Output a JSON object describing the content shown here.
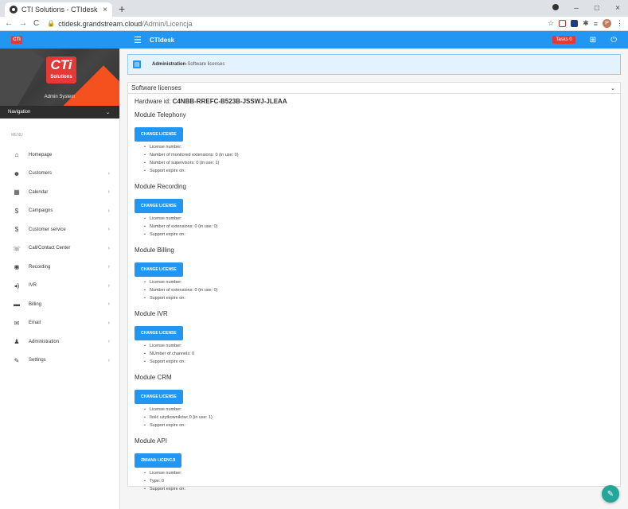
{
  "browser": {
    "tab_title": "CTI Solutions - CTIdesk",
    "tab_close": "×",
    "new_tab": "+",
    "url_host": "ctidesk.grandstream.cloud",
    "url_path": "/Admin/Licencja",
    "win_min": "–",
    "win_max": "□",
    "win_close": "×",
    "profile_initial": "P"
  },
  "header": {
    "brand": "CTIdesk",
    "tasks_label": "Tasks 0",
    "logo_mini": "CTi"
  },
  "sidebar": {
    "logo_big": "CTi",
    "logo_small": "Solutions",
    "user_name": "Admin System",
    "navigation_label": "Navigation",
    "menu_label": "MENU",
    "items": [
      {
        "label": "Homepage",
        "icon": "⌂",
        "chev": ""
      },
      {
        "label": "Customers",
        "icon": "☻",
        "chev": "›"
      },
      {
        "label": "Calendar",
        "icon": "▦",
        "chev": "›"
      },
      {
        "label": "Campaigns",
        "icon": "$",
        "chev": "›"
      },
      {
        "label": "Customer service",
        "icon": "$",
        "chev": "›"
      },
      {
        "label": "Call/Contact Center",
        "icon": "☏",
        "chev": "›"
      },
      {
        "label": "Recording",
        "icon": "◉",
        "chev": "›"
      },
      {
        "label": "IVR",
        "icon": "◂)",
        "chev": "›"
      },
      {
        "label": "Billing",
        "icon": "▬",
        "chev": "›"
      },
      {
        "label": "Email",
        "icon": "✉",
        "chev": "›"
      },
      {
        "label": "Administration",
        "icon": "♟",
        "chev": "›"
      },
      {
        "label": "Settings",
        "icon": "✎",
        "chev": "›"
      }
    ]
  },
  "breadcrumb": {
    "section": "Administration",
    "separator": " - ",
    "page": "Software licenses"
  },
  "card": {
    "title": "Software licenses",
    "hardware_label": "Hardware id: ",
    "hardware_id": "C4NBB-RREFC-B523B-JSSWJ-JLEAA"
  },
  "modules": [
    {
      "title": "Module Telephony",
      "button": "CHANGE LICENSE",
      "lines": [
        "License number:",
        "Number of monitored extensions: 0 (in use: 0)",
        "Number of supervisors: 0 (in use: 1)",
        "Support expire on:"
      ]
    },
    {
      "title": "Module Recording",
      "button": "CHANGE LICENSE",
      "lines": [
        "License number:",
        "Number of extensions: 0 (in use: 0)",
        "Support expire on:"
      ]
    },
    {
      "title": "Module Billing",
      "button": "CHANGE LICENSE",
      "lines": [
        "License number:",
        "Number of extensions: 0 (in use: 0)",
        "Support expire on:"
      ]
    },
    {
      "title": "Module IVR",
      "button": "CHANGE LICENSE",
      "lines": [
        "License number:",
        "NUmber of channels: 0",
        "Support expire on:"
      ]
    },
    {
      "title": "Module CRM",
      "button": "CHANGE LICENSE",
      "lines": [
        "License number:",
        "Ilość użytkowników: 0 (in use: 1)",
        "Support expire on:"
      ]
    },
    {
      "title": "Module API",
      "button": "ZMIANA LICENCJI",
      "lines": [
        "License number:",
        "Type: 0",
        "Support expire on:"
      ]
    }
  ],
  "colors": {
    "primary": "#2196f3",
    "danger": "#e53935",
    "fab": "#26a69a"
  }
}
